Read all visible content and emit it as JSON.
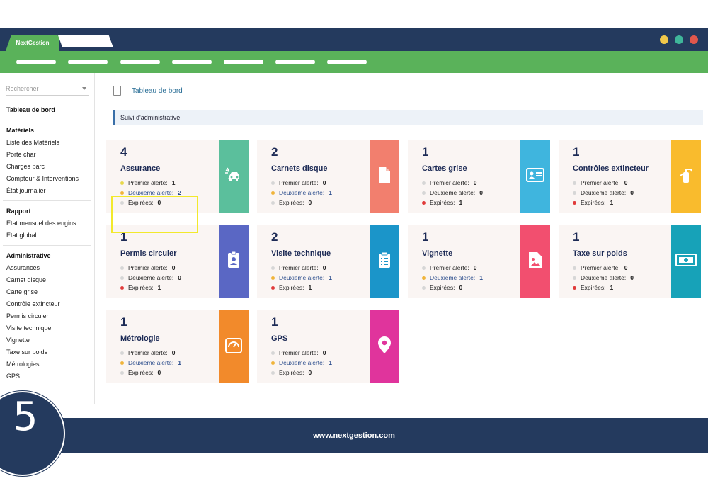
{
  "app": {
    "tab_label": "NextGestion",
    "footer_url": "www.nextgestion.com",
    "step_number": "5"
  },
  "window_dots": [
    "#f1c84a",
    "#3fb69a",
    "#e2574c"
  ],
  "sidebar": {
    "search_placeholder": "Rechercher",
    "sections": [
      {
        "head": "Tableau de bord",
        "items": []
      },
      {
        "head": "Matériels",
        "items": [
          "Liste des Matériels",
          "Porte char",
          "Charges parc",
          "Compteur & Interventions",
          "État journalier"
        ]
      },
      {
        "head": "Rapport",
        "items": [
          "État mensuel des engins",
          "État global"
        ]
      },
      {
        "head": "Administrative",
        "items": [
          "Assurances",
          "Carnet disque",
          "Carte grise",
          "Contrôle extincteur",
          "Permis circuler",
          "Visite technique",
          "Vignette",
          "Taxe sur poids",
          "Métrologies",
          "GPS"
        ]
      }
    ]
  },
  "breadcrumb": {
    "label": "Tableau de bord"
  },
  "section_title": "Suivi d'administrative",
  "labels": {
    "premier": "Premier alerte:",
    "deuxieme": "Deuxième alerte:",
    "expirees": "Expirées:"
  },
  "cards": [
    {
      "count": "4",
      "title": "Assurance",
      "premier": "1",
      "deuxieme": "2",
      "expirees": "0",
      "color": "#5bbf9c",
      "icon": "car-crash-icon",
      "dots": [
        "#e8d84a",
        "#f0b43a",
        "#d6d6d6"
      ]
    },
    {
      "count": "2",
      "title": "Carnets disque",
      "premier": "0",
      "deuxieme": "1",
      "expirees": "0",
      "color": "#f27f6e",
      "icon": "document-icon",
      "dots": [
        "#d6d6d6",
        "#f0b43a",
        "#d6d6d6"
      ]
    },
    {
      "count": "1",
      "title": "Cartes grise",
      "premier": "0",
      "deuxieme": "0",
      "expirees": "1",
      "color": "#3fb5de",
      "icon": "id-card-icon",
      "dots": [
        "#d6d6d6",
        "#d6d6d6",
        "#e03a3a"
      ]
    },
    {
      "count": "1",
      "title": "Contrôles extincteur",
      "premier": "0",
      "deuxieme": "0",
      "expirees": "1",
      "color": "#f9bb2d",
      "icon": "fire-extinguisher-icon",
      "dots": [
        "#d6d6d6",
        "#d6d6d6",
        "#e03a3a"
      ]
    },
    {
      "count": "1",
      "title": "Permis circuler",
      "premier": "0",
      "deuxieme": "0",
      "expirees": "1",
      "color": "#5a67c4",
      "icon": "badge-icon",
      "dots": [
        "#d6d6d6",
        "#d6d6d6",
        "#e03a3a"
      ]
    },
    {
      "count": "2",
      "title": "Visite technique",
      "premier": "0",
      "deuxieme": "1",
      "expirees": "1",
      "color": "#1b95c9",
      "icon": "clipboard-icon",
      "dots": [
        "#d6d6d6",
        "#f0b43a",
        "#e03a3a"
      ]
    },
    {
      "count": "1",
      "title": "Vignette",
      "premier": "0",
      "deuxieme": "1",
      "expirees": "0",
      "color": "#f24f6f",
      "icon": "image-file-icon",
      "dots": [
        "#d6d6d6",
        "#f0b43a",
        "#d6d6d6"
      ]
    },
    {
      "count": "1",
      "title": "Taxe sur poids",
      "premier": "0",
      "deuxieme": "0",
      "expirees": "1",
      "color": "#17a2b8",
      "icon": "money-bill-icon",
      "dots": [
        "#d6d6d6",
        "#d6d6d6",
        "#e03a3a"
      ]
    },
    {
      "count": "1",
      "title": "Métrologie",
      "premier": "0",
      "deuxieme": "1",
      "expirees": "0",
      "color": "#f28a2b",
      "icon": "gauge-icon",
      "dots": [
        "#d6d6d6",
        "#f0b43a",
        "#d6d6d6"
      ]
    },
    {
      "count": "1",
      "title": "GPS",
      "premier": "0",
      "deuxieme": "1",
      "expirees": "0",
      "color": "#e0349c",
      "icon": "map-marker-icon",
      "dots": [
        "#d6d6d6",
        "#f0b43a",
        "#d6d6d6"
      ]
    }
  ]
}
